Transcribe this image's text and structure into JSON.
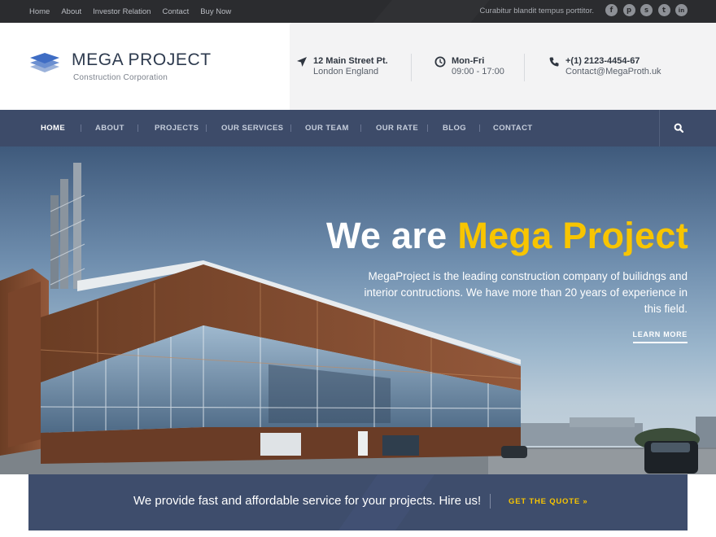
{
  "topbar": {
    "links": [
      "Home",
      "About",
      "Investor Relation",
      "Contact",
      "Buy Now"
    ],
    "tagline": "Curabitur blandit tempus porttitor.",
    "socials": [
      {
        "icon": "facebook-icon",
        "glyph": "f"
      },
      {
        "icon": "pinterest-icon",
        "glyph": "p"
      },
      {
        "icon": "skype-icon",
        "glyph": "s"
      },
      {
        "icon": "twitter-icon",
        "glyph": "t"
      },
      {
        "icon": "linkedin-icon",
        "glyph": "in"
      }
    ]
  },
  "header": {
    "brand_name": "MEGA PROJECT",
    "brand_sub": "Construction Corporation",
    "address": {
      "line1": "12 Main Street Pt.",
      "line2": "London England",
      "icon": "location-arrow-icon"
    },
    "hours": {
      "line1": "Mon-Fri",
      "line2": "09:00 - 17:00",
      "icon": "clock-icon"
    },
    "contact": {
      "line1": "+(1) 2123-4454-67",
      "line2": "Contact@MegaProth.uk",
      "icon": "phone-icon"
    }
  },
  "nav": {
    "items": [
      "HOME",
      "ABOUT",
      "PROJECTS",
      "OUR SERVICES",
      "OUR TEAM",
      "OUR RATE",
      "BLOG",
      "CONTACT"
    ],
    "active": "HOME",
    "search_icon": "search-icon"
  },
  "hero": {
    "title_white": "We are",
    "title_highlight": "Mega Project",
    "description": "MegaProject is the leading construction company of builidngs and interior contructions. We have more than 20 years of experience in this field.",
    "learn_more": "LEARN MORE"
  },
  "cta": {
    "text": "We provide fast and affordable service for your projects. Hire us!",
    "button": "GET THE QUOTE »"
  },
  "colors": {
    "accent": "#f8c500",
    "nav": "#3d4b69",
    "topbar": "#2b2c2f",
    "brand": "#2d3a4e"
  }
}
